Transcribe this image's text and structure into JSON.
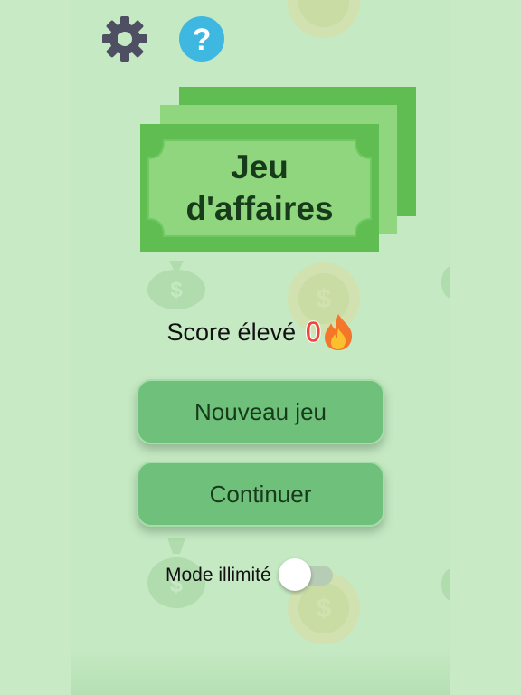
{
  "app": {
    "title_line1": "Jeu",
    "title_line2": "d'affaires"
  },
  "toolbar": {
    "settings_icon": "gear-icon",
    "help_icon": "question-mark-icon",
    "help_glyph": "?"
  },
  "score": {
    "label": "Score élevé",
    "value": "0",
    "icon": "fire-icon"
  },
  "menu": {
    "new_game_label": "Nouveau jeu",
    "continue_label": "Continuer"
  },
  "mode": {
    "label": "Mode illimité",
    "enabled": false
  },
  "colors": {
    "background": "#c8ebc6",
    "button": "#6fc07a",
    "bill": "#5fbd52",
    "score_value": "#f0463a",
    "help_icon": "#3eb8e0",
    "gear_icon": "#4f4f63"
  }
}
